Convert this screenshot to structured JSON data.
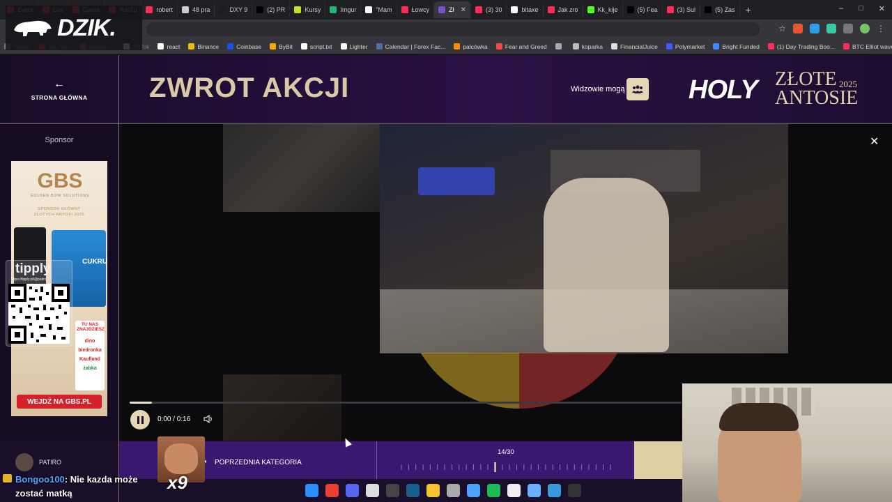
{
  "browser": {
    "tabs": [
      {
        "label": "Zwrot",
        "color": "#ff2d2d"
      },
      {
        "label": "Gra",
        "color": "#ff2d2d"
      },
      {
        "label": "Gama",
        "color": "#ff2d2d"
      },
      {
        "label": "YouTu",
        "color": "#ff2d2d"
      },
      {
        "label": "robert",
        "color": "#ff2d55"
      },
      {
        "label": "48 pra",
        "color": "#cccccc"
      },
      {
        "label": "DXY 9",
        "color": "#1d1d1d"
      },
      {
        "label": "(2) PR",
        "color": "#000000"
      },
      {
        "label": "Kursy",
        "color": "#c6e027"
      },
      {
        "label": "Imgur",
        "color": "#1bb76e"
      },
      {
        "label": "\"Mam",
        "color": "#ffffff"
      },
      {
        "label": "Łowcy",
        "color": "#ff2d55"
      },
      {
        "label": "Zł",
        "color": "#7b4dd1"
      },
      {
        "label": "(3) 30",
        "color": "#ff2d55"
      },
      {
        "label": "bitaxe",
        "color": "#ffffff"
      },
      {
        "label": "Jak zro",
        "color": "#ff2d55"
      },
      {
        "label": "Kk_kije",
        "color": "#53fc18"
      },
      {
        "label": "(5) Fea",
        "color": "#000000"
      },
      {
        "label": "(3) Sul",
        "color": "#ff2d55"
      },
      {
        "label": "(5) Zas",
        "color": "#000000"
      }
    ],
    "active_tab_index": 12,
    "new_tab": "+",
    "window_controls": [
      "–",
      "□",
      "✕"
    ],
    "address": ""
  },
  "bookmarks": [
    {
      "label": "Twitter",
      "color": "#777777",
      "faded": true
    },
    {
      "label": "YouTube",
      "color": "#ff2d2d",
      "faded": true
    },
    {
      "label": "Instagram",
      "color": "#c13584",
      "faded": true
    },
    {
      "label": "TikTok",
      "color": "#ffffff",
      "faded": true
    },
    {
      "label": "react",
      "color": "#ffffff",
      "faded": false
    },
    {
      "label": "Binance",
      "color": "#f0b90b",
      "faded": false
    },
    {
      "label": "Coinbase",
      "color": "#1652f0",
      "faded": false
    },
    {
      "label": "ByBit",
      "color": "#f7a600",
      "faded": false
    },
    {
      "label": "script.txt",
      "color": "#ffffff",
      "faded": false
    },
    {
      "label": "Lighter",
      "color": "#ffffff",
      "faded": false
    },
    {
      "label": "Calendar | Forex Fac...",
      "color": "#4a6fa5",
      "faded": false
    },
    {
      "label": "palcówka",
      "color": "#ff8800",
      "faded": false
    },
    {
      "label": "Fear and Greed",
      "color": "#ff4444",
      "faded": false
    },
    {
      "label": "",
      "color": "#aaaaaa",
      "faded": false
    },
    {
      "label": "koparka",
      "color": "#bbbbbb",
      "faded": false
    },
    {
      "label": "FinancialJuice",
      "color": "#dddddd",
      "faded": false
    },
    {
      "label": "Polymarket",
      "color": "#3d5afe",
      "faded": false
    },
    {
      "label": "Bright Funded",
      "color": "#3d8bff",
      "faded": false
    },
    {
      "label": "(1) Day Trading Boo...",
      "color": "#ff2d55",
      "faded": false
    },
    {
      "label": "BTC Elliot wave",
      "color": "#ff2d55",
      "faded": false
    }
  ],
  "overlay_logo": {
    "text": "DZIK."
  },
  "header": {
    "back_label": "STRONA GŁÓWNA",
    "back_arrow": "←",
    "category_title": "ZWROT AKCJI",
    "viewers_label": "Widzowie mogą",
    "viewers_icon": "users-icon",
    "event_holy": "HOLY",
    "event_title": "ZŁOTE\nANTOSIE",
    "event_year": "2025"
  },
  "sidebar": {
    "sponsor_label": "Sponsor",
    "ad": {
      "brand": "GBS",
      "brand_sub": "GOLDEN BOW SOLUTIONS",
      "main_sponsor": "SPONSOR GŁÓWNY\nZŁOTYCH ANTOSI 2025",
      "product_text": "CUKRU",
      "tu_nas_label": "TU NAS ZNAJDZIESZ",
      "shops": [
        {
          "name": "dino",
          "color": "#d6202a"
        },
        {
          "name": "biedronka",
          "color": "#d6202a"
        },
        {
          "name": "Kaufland",
          "color": "#d6202a"
        },
        {
          "name": "żabka",
          "color": "#1f8a3a"
        }
      ],
      "cta": "WEJDŹ NA GBS.PL"
    }
  },
  "tipply": {
    "title": "tipply",
    "url": "https://tipply.pl/@patiro"
  },
  "video": {
    "close_icon": "close-icon",
    "time": "0:00 / 0:16",
    "progress": 0.04,
    "state": "playing",
    "volume_icon": "volume-icon"
  },
  "bottom_nav": {
    "prev_label": "POPRZEDNIA KATEGORIA",
    "counter": "14/30",
    "current": 14,
    "total": 30
  },
  "stream": {
    "emote_count": "x9",
    "chat": {
      "user": "PATIRO",
      "author": "Bongoo100",
      "message": ": Nie kazda może zostać matką"
    }
  },
  "taskbar": [
    {
      "name": "windows-icon",
      "color": "#2f8cff"
    },
    {
      "name": "chrome-icon",
      "color": "#e94235"
    },
    {
      "name": "discord-icon",
      "color": "#5865f2"
    },
    {
      "name": "app-icon",
      "color": "#dddddd"
    },
    {
      "name": "obs-icon",
      "color": "#444444"
    },
    {
      "name": "steam-icon",
      "color": "#1b5f8f"
    },
    {
      "name": "folder-icon",
      "color": "#f4c430"
    },
    {
      "name": "ccleaner-icon",
      "color": "#aaaaaa"
    },
    {
      "name": "tool-icon",
      "color": "#4aa3ff"
    },
    {
      "name": "spotify-icon",
      "color": "#1db954"
    },
    {
      "name": "store-icon",
      "color": "#eeeeee"
    },
    {
      "name": "notepad-icon",
      "color": "#6ab0ff"
    },
    {
      "name": "photos-icon",
      "color": "#3a9bdc"
    },
    {
      "name": "terminal-icon",
      "color": "#333333"
    }
  ]
}
